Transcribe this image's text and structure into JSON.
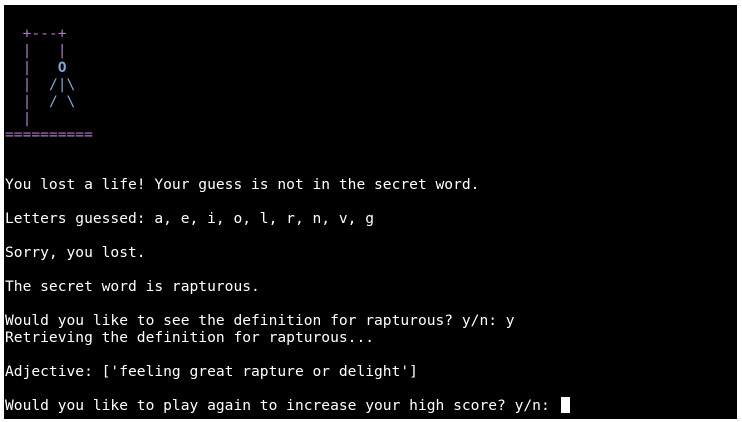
{
  "hangman": {
    "top": "  +---+",
    "row1": "  |   |",
    "row2": [
      "  |   ",
      "O"
    ],
    "row3": [
      "  |  ",
      "/|\\"
    ],
    "row4": [
      "  |  ",
      "/ \\"
    ],
    "row5": "  |",
    "base": "=========="
  },
  "messages": {
    "lost_life": "You lost a life! Your guess is not in the secret word.",
    "letters_guessed": "Letters guessed: a, e, i, o, l, r, n, v, g",
    "sorry": "Sorry, you lost.",
    "secret_word": "The secret word is rapturous.",
    "definition_prompt": "Would you like to see the definition for rapturous? y/n: y",
    "retrieving": "Retrieving the definition for rapturous...",
    "definition": "Adjective: ['feeling great rapture or delight']",
    "play_again_prompt": "Would you like to play again to increase your high score? y/n: "
  },
  "colors": {
    "gallows": "#b07cc6",
    "figure": "#7fa8d8",
    "text": "#ffffff",
    "background": "#000000"
  }
}
